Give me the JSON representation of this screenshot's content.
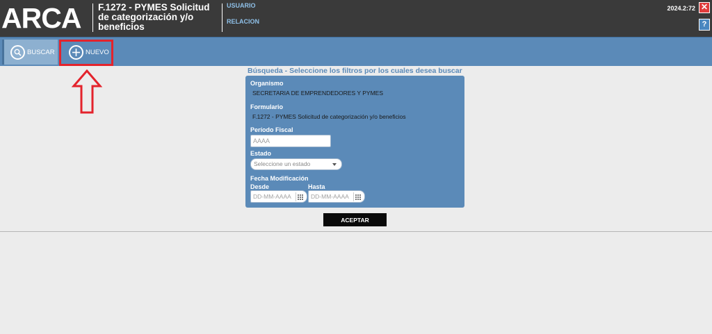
{
  "header": {
    "logo": "ARCA",
    "form_title": "F.1272 - PYMES Solicitud de categorización y/o beneficios",
    "user_link": "USUARIO",
    "relation_link": "RELACION",
    "version": "2024.2:72",
    "close_glyph": "✕",
    "help_glyph": "?"
  },
  "toolbar": {
    "buscar_label": "BUSCAR",
    "nuevo_label": "NUEVO"
  },
  "search": {
    "title": "Búsqueda - Seleccione los filtros por los cuales desea buscar",
    "organismo_label": "Organismo",
    "organismo_value": "SECRETARIA DE EMPRENDEDORES Y PYMES",
    "formulario_label": "Formulario",
    "formulario_value": "F.1272 - PYMES Solicitud de categorización y/o beneficios",
    "periodo_label": "Período Fiscal",
    "periodo_placeholder": "AAAA",
    "estado_label": "Estado",
    "estado_placeholder": "Seleccione un estado",
    "fecha_label": "Fecha Modificación",
    "desde_label": "Desde",
    "hasta_label": "Hasta",
    "date_placeholder": "DD-MM-AAAA",
    "accept_label": "ACEPTAR"
  },
  "colors": {
    "header_bg": "#3a3a3a",
    "toolbar_bg": "#5b8ab8",
    "highlight": "#e3232c"
  },
  "icons": [
    "search-icon",
    "plus-icon",
    "close-icon",
    "help-icon",
    "calendar-icon",
    "chevron-down-icon",
    "arrow-up-icon"
  ]
}
